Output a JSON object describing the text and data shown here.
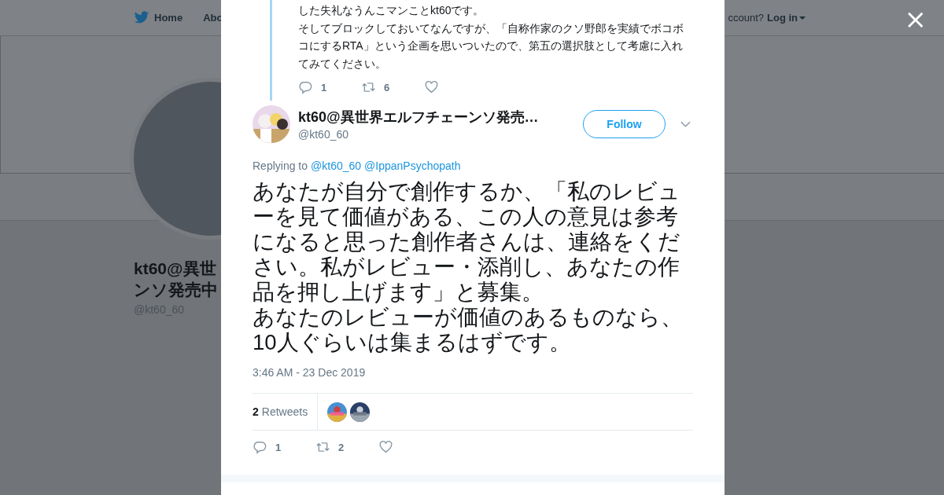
{
  "top_nav": {
    "items": [
      {
        "label": "Home",
        "kind": "home"
      },
      {
        "label": "Abo",
        "kind": "plain"
      }
    ],
    "account_prompt": "ccount?",
    "login": "Log in"
  },
  "profile": {
    "name_lines": [
      "kt60@異世",
      "ンソ発売中"
    ],
    "handle": "@kt60_60"
  },
  "modal": {
    "close": "×",
    "parent_tweet": {
      "paragraphs": [
        "した失礼なうんこマンことkt60です。",
        "そしてブロックしておいてなんですが、「自称作家のクソ野郎を実績でボコボコにするRTA」という企画を思いついたので、第五の選択肢として考慮に入れてみてください。"
      ],
      "replies": "1",
      "retweets": "6"
    },
    "tweet": {
      "author": "kt60@異世界エルフチェーンソ発売…",
      "handle": "@kt60_60",
      "follow": "Follow",
      "replying_label": "Replying to",
      "replying_to": [
        "@kt60_60",
        "@IppanPsychopath"
      ],
      "paragraphs": [
        "あなたが自分で創作するか、「私のレビューを見て価値がある、この人の意見は参考になると思った創作者さんは、連絡をください。私がレビュー・添削し、あなたの作品を押し上げます」と募集。",
        "あなたのレビューが価値のあるものなら、10人ぐらいは集まるはずです。"
      ],
      "timestamp": "3:46 AM - 23 Dec 2019",
      "retweet_count": "2",
      "retweet_label": "Retweets",
      "replies": "1",
      "retweets": "2"
    }
  }
}
